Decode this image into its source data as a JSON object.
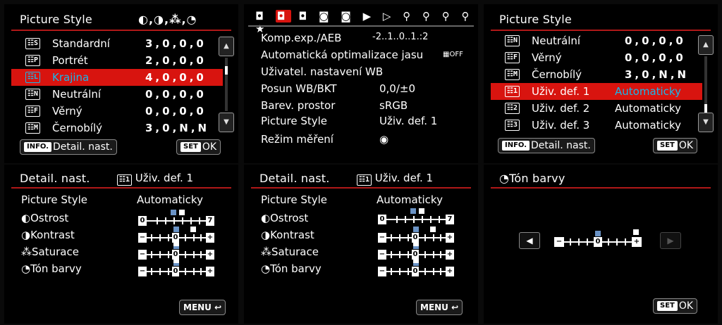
{
  "p1": {
    "title": "Picture Style",
    "icons": "◐,◑,⁂,◔",
    "rows": [
      {
        "icon": "S",
        "name": "Standardní",
        "vals": "3,0,0,0"
      },
      {
        "icon": "P",
        "name": "Portrét",
        "vals": "2,0,0,0"
      },
      {
        "icon": "L",
        "name": "Krajina",
        "vals": "4,0,0,0"
      },
      {
        "icon": "N",
        "name": "Neutrální",
        "vals": "0,0,0,0"
      },
      {
        "icon": "F",
        "name": "Věrný",
        "vals": "0,0,0,0"
      },
      {
        "icon": "M",
        "name": "Černobílý",
        "vals": "3,0,N,N"
      }
    ],
    "info_chip": "INFO.",
    "info_label": "Detail. nast.",
    "set_chip": "SET",
    "ok": "OK"
  },
  "p2": {
    "tabs_before": "◘",
    "tabs_active": "◘",
    "tabs_after": "◘ ◙ ◙ ▶ ▷ ⚲ ⚲ ⚲ ⚲ ★",
    "rows": [
      {
        "name": "Komp.exp./AEB",
        "val": "-2..1..0..1.:2"
      },
      {
        "name": "Automatická optimalizace jasu",
        "val": "▦OFF"
      },
      {
        "name": "Uživatel. nastavení WB",
        "val": ""
      },
      {
        "name": "Posun WB/BKT",
        "val": "0,0/±0"
      },
      {
        "name": "Barev. prostor",
        "val": "sRGB"
      },
      {
        "name": "Picture Style",
        "val": "Uživ. def. 1"
      },
      {
        "name": "Režim měření",
        "val": "◉"
      }
    ]
  },
  "p3": {
    "title": "Picture Style",
    "rows": [
      {
        "icon": "N",
        "name": "Neutrální",
        "vals": "0,0,0,0"
      },
      {
        "icon": "F",
        "name": "Věrný",
        "vals": "0,0,0,0"
      },
      {
        "icon": "M",
        "name": "Černobílý",
        "vals": "3,0,N,N"
      },
      {
        "icon": "1",
        "name": "Uživ. def. 1",
        "vals": "Automaticky"
      },
      {
        "icon": "2",
        "name": "Uživ. def. 2",
        "vals": "Automaticky"
      },
      {
        "icon": "3",
        "name": "Uživ. def. 3",
        "vals": "Automaticky"
      }
    ],
    "info_chip": "INFO.",
    "info_label": "Detail. nast.",
    "set_chip": "SET",
    "ok": "OK"
  },
  "detail": {
    "title": "Detail. nast.",
    "style_icon": "1",
    "style_name": "Uživ. def. 1",
    "row_ps": "Picture Style",
    "row_ps_val": "Automaticky",
    "sharp": "Ostrost",
    "contrast": "Kontrast",
    "sat": "Saturace",
    "tone": "Tón barvy",
    "sharp_min": "0",
    "sharp_max": "7",
    "minus": "−",
    "plus": "+",
    "zero": "0",
    "menu_label": "MENU",
    "menu_icon": "↩"
  },
  "p6": {
    "title": "Tón barvy",
    "left": "◀",
    "right": "▶",
    "set_chip": "SET",
    "ok": "OK"
  }
}
